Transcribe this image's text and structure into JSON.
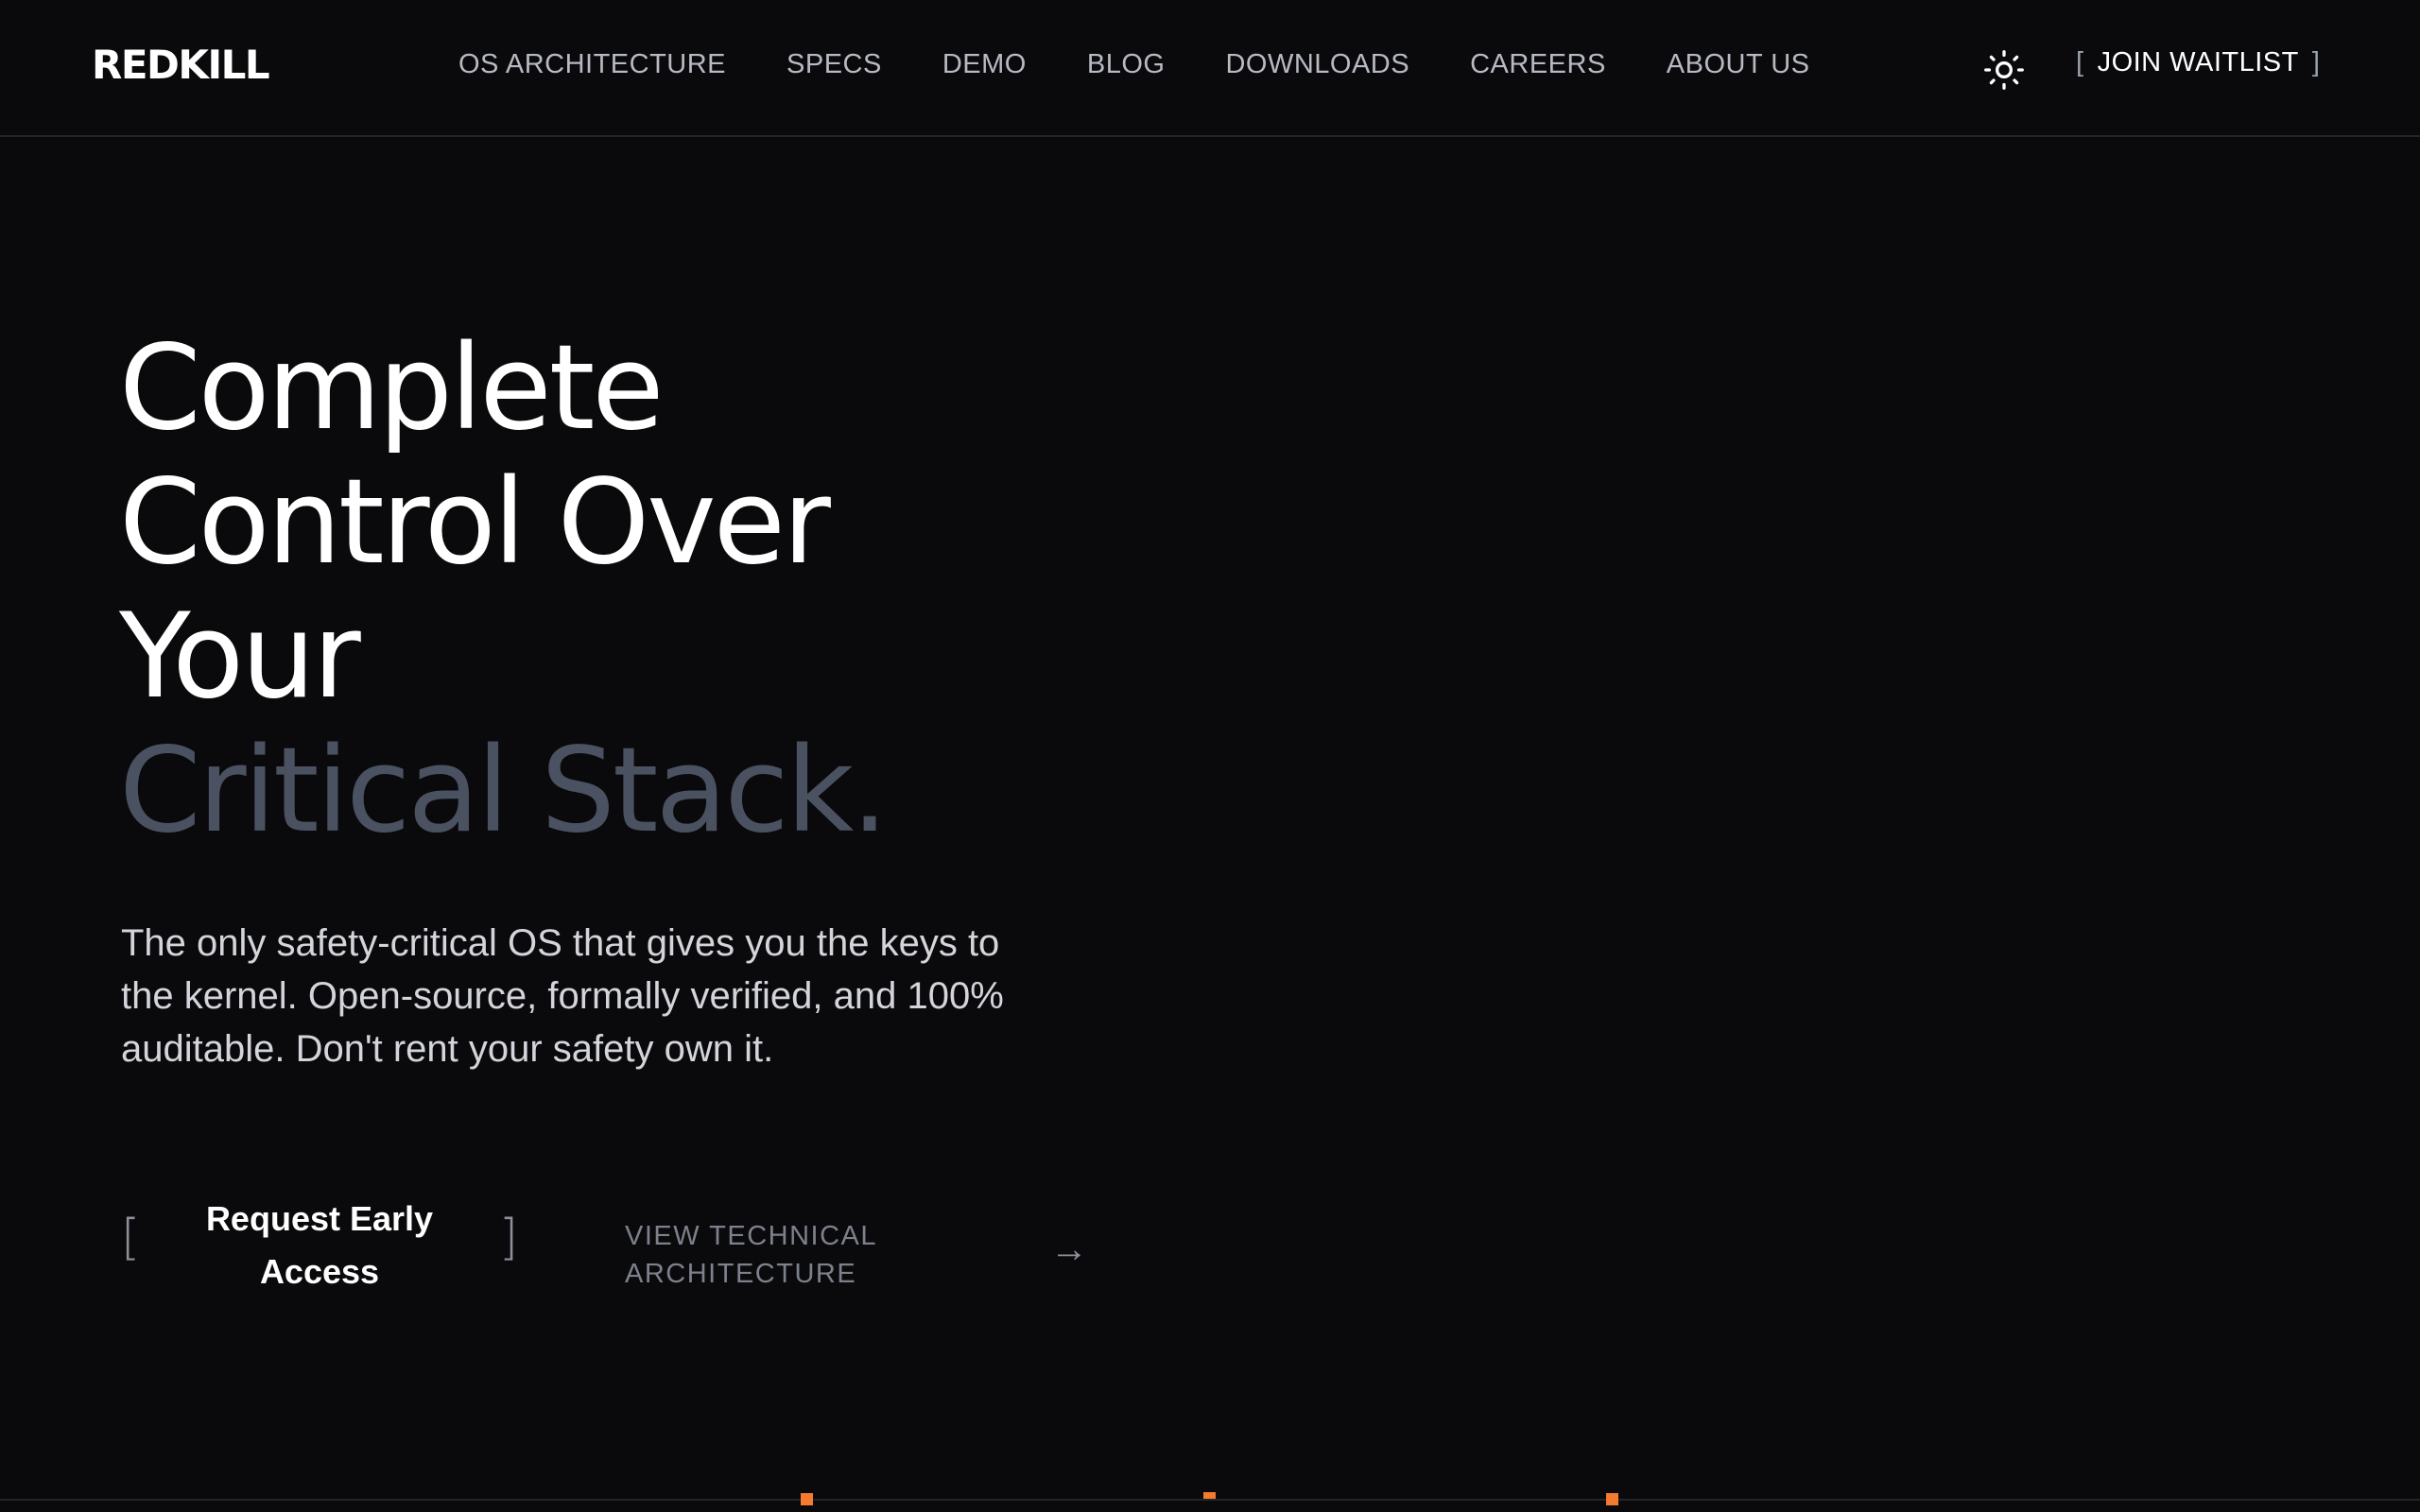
{
  "brand": {
    "logo": "REDKILL",
    "accent_color": "#f47a2f"
  },
  "nav": {
    "items": [
      {
        "label": "OS ARCHITECTURE"
      },
      {
        "label": "SPECS"
      },
      {
        "label": "DEMO"
      },
      {
        "label": "BLOG"
      },
      {
        "label": "DOWNLOADS"
      },
      {
        "label": "CAREERS"
      },
      {
        "label": "ABOUT US"
      }
    ],
    "theme_toggle_icon": "sun-icon",
    "waitlist": {
      "bracket_open": "[",
      "label": "JOIN WAITLIST",
      "bracket_close": "]"
    }
  },
  "hero": {
    "title_lines": [
      "Complete",
      "Control Over",
      "Your"
    ],
    "title_highlight": "Critical Stack.",
    "subtitle": "The only safety-critical OS that gives you the keys to the kernel. Open-source, formally verified, and 100% auditable. Don't rent your safety own it.",
    "primary_cta": {
      "bracket_open": "[",
      "label": "Request Early Access",
      "bracket_close": "]"
    },
    "secondary_cta": {
      "label": "VIEW TECHNICAL ARCHITECTURE",
      "arrow": "→"
    }
  }
}
